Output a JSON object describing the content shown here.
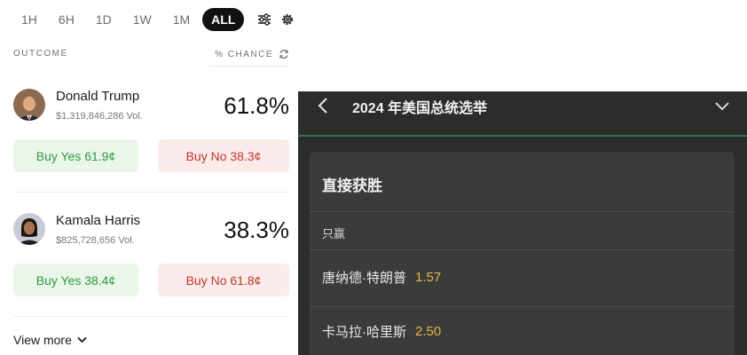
{
  "time_tabs": [
    "1H",
    "6H",
    "1D",
    "1W",
    "1M",
    "ALL"
  ],
  "active_tab": "ALL",
  "header": {
    "outcome": "OUTCOME",
    "chance": "% CHANCE"
  },
  "candidates": [
    {
      "name": "Donald Trump",
      "volume": "$1,319,846,286 Vol.",
      "chance": "61.8%",
      "buy_yes": "Buy Yes 61.9¢",
      "buy_no": "Buy No 38.3¢"
    },
    {
      "name": "Kamala Harris",
      "volume": "$825,728,656 Vol.",
      "chance": "38.3%",
      "buy_yes": "Buy Yes 38.4¢",
      "buy_no": "Buy No 61.8¢"
    }
  ],
  "view_more": "View more",
  "right_panel": {
    "title": "2024 年美国总统选举",
    "card_title": "直接获胜",
    "subheader": "只赢",
    "rows": [
      {
        "name": "唐纳德·特朗普",
        "odds": "1.57"
      },
      {
        "name": "卡马拉·哈里斯",
        "odds": "2.50"
      }
    ]
  },
  "colors": {
    "yes_green": "#2f9a3f",
    "no_red": "#c0392b",
    "odds_gold": "#e9b44c",
    "dark_bg": "#2b2d2b"
  }
}
